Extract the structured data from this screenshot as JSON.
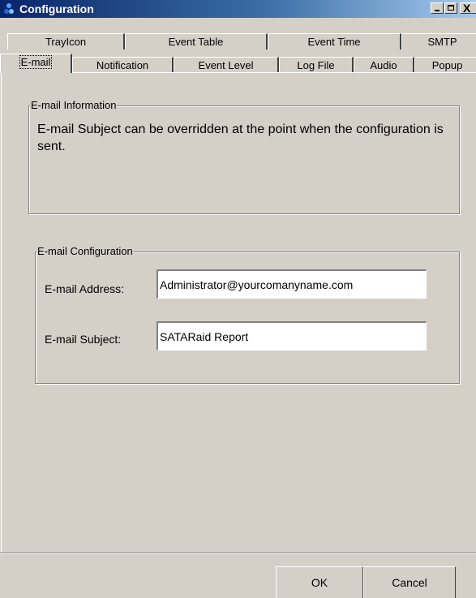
{
  "window": {
    "title": "Configuration",
    "controls": {
      "minimize": "_",
      "maximize": "□",
      "close": "X"
    }
  },
  "tabs": {
    "row1": [
      {
        "label": "TrayIcon"
      },
      {
        "label": "Event Table"
      },
      {
        "label": "Event Time"
      },
      {
        "label": "SMTP"
      }
    ],
    "row2": [
      {
        "label": "E-mail",
        "active": true
      },
      {
        "label": "Notification"
      },
      {
        "label": "Event Level"
      },
      {
        "label": "Log File"
      },
      {
        "label": "Audio"
      },
      {
        "label": "Popup"
      }
    ]
  },
  "email_info": {
    "legend": "E-mail Information",
    "text": "E-mail Subject can be overridden at the point when the configuration is sent."
  },
  "email_config": {
    "legend": "E-mail Configuration",
    "address_label": "E-mail Address:",
    "address_value": "Administrator@yourcomanyname.com",
    "subject_label": "E-mail Subject:",
    "subject_value": "SATARaid Report"
  },
  "buttons": {
    "ok": "OK",
    "cancel": "Cancel"
  },
  "colors": {
    "titlebar_start": "#0a246a",
    "titlebar_end": "#a6caf0",
    "face": "#d4d0c8"
  }
}
